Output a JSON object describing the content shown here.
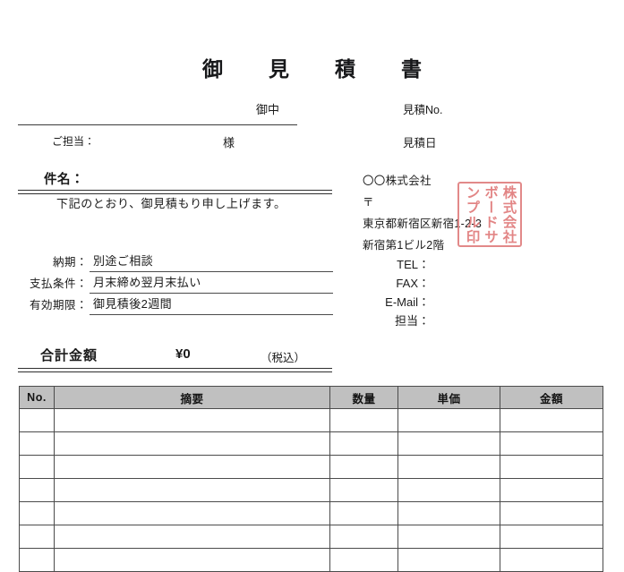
{
  "document": {
    "title": "御　見　積　書"
  },
  "customer": {
    "onchu": "御中",
    "tantou_label": "ご担当：",
    "sama": "様"
  },
  "meta": {
    "estimate_no_label": "見積No.",
    "estimate_date_label": "見積日"
  },
  "subject": {
    "label": "件名：",
    "lead_text": "下記のとおり、御見積もり申し上げます。"
  },
  "terms": [
    {
      "label": "納期：",
      "value": "別途ご相談"
    },
    {
      "label": "支払条件：",
      "value": "月末締め翌月末払い"
    },
    {
      "label": "有効期限：",
      "value": "御見積後2週間"
    }
  ],
  "seller": {
    "company": "〇〇株式会社",
    "postal_mark": "〒",
    "address_line1": "東京都新宿区新宿1-2-3",
    "address_line2": "新宿第1ビル2階",
    "tel_label": "TEL：",
    "fax_label": "FAX：",
    "email_label": "E-Mail：",
    "contact_label": "担当："
  },
  "seal": {
    "column_1": "株式会社",
    "column_2": "ボードサ",
    "column_3": "ンプル印",
    "color": "#e07b7b"
  },
  "total": {
    "label": "合計金額",
    "value": "¥0",
    "tax_note": "（税込）"
  },
  "items_table": {
    "columns": [
      "No.",
      "摘要",
      "数量",
      "単価",
      "金額"
    ],
    "header_bg": "#c0c0c0",
    "rows": [
      {
        "no": "",
        "desc": "",
        "qty": "",
        "price": "",
        "amount": ""
      },
      {
        "no": "",
        "desc": "",
        "qty": "",
        "price": "",
        "amount": ""
      },
      {
        "no": "",
        "desc": "",
        "qty": "",
        "price": "",
        "amount": ""
      },
      {
        "no": "",
        "desc": "",
        "qty": "",
        "price": "",
        "amount": ""
      },
      {
        "no": "",
        "desc": "",
        "qty": "",
        "price": "",
        "amount": ""
      },
      {
        "no": "",
        "desc": "",
        "qty": "",
        "price": "",
        "amount": ""
      },
      {
        "no": "",
        "desc": "",
        "qty": "",
        "price": "",
        "amount": ""
      }
    ]
  }
}
